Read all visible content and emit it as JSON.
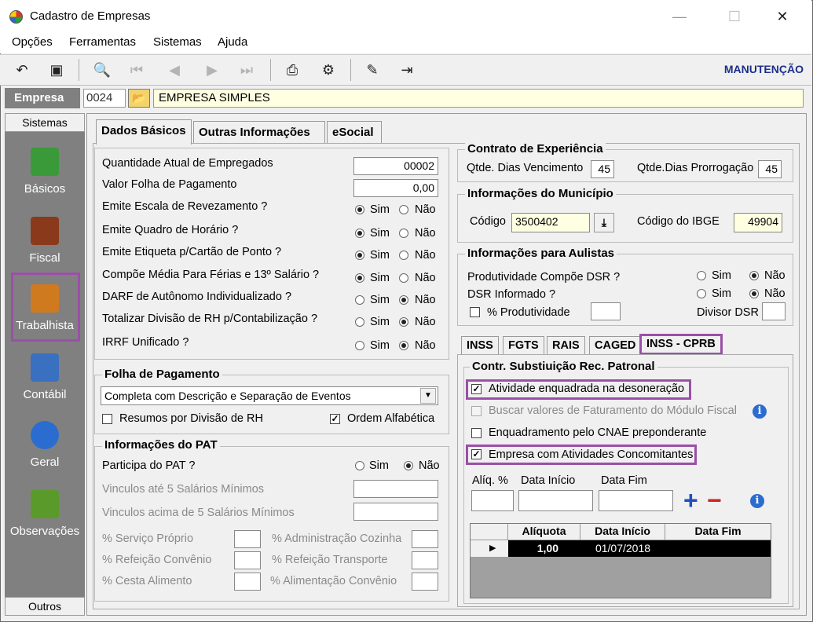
{
  "window": {
    "title": "Cadastro de Empresas",
    "minimize": "—",
    "maximize": "☐",
    "close": "✕"
  },
  "menu": [
    "Opções",
    "Ferramentas",
    "Sistemas",
    "Ajuda"
  ],
  "toolbar": {
    "mode": "MANUTENÇÃO"
  },
  "empresa": {
    "label": "Empresa",
    "code": "0024",
    "name": "EMPRESA SIMPLES"
  },
  "sidebar": {
    "header": "Sistemas",
    "footer": "Outros",
    "items": [
      {
        "label": "Básicos",
        "color": "#3a9a3a"
      },
      {
        "label": "Fiscal",
        "color": "#8a3a1a"
      },
      {
        "label": "Trabalhista",
        "color": "#d07a20"
      },
      {
        "label": "Contábil",
        "color": "#3a70c0"
      },
      {
        "label": "Geral",
        "color": "#2b6cd0"
      },
      {
        "label": "Observações",
        "color": "#5a9a2a"
      }
    ]
  },
  "tabs": [
    "Dados Básicos",
    "Outras Informações",
    "eSocial"
  ],
  "basic": {
    "rows": [
      {
        "label": "Quantidade Atual de Empregados",
        "value": "00002"
      },
      {
        "label": "Valor Folha de Pagamento",
        "value": "0,00"
      }
    ],
    "radio_rows": [
      {
        "label": "Emite Escala de Revezamento ?",
        "sel": "sim"
      },
      {
        "label": "Emite Quadro de Horário ?",
        "sel": "sim"
      },
      {
        "label": "Emite Etiqueta p/Cartão de Ponto ?",
        "sel": "sim"
      },
      {
        "label": "Compõe Média Para Férias e 13º Salário ?",
        "sel": "sim"
      },
      {
        "label": "DARF de Autônomo Individualizado ?",
        "sel": "nao"
      },
      {
        "label": "Totalizar Divisão de RH p/Contabilização ?",
        "sel": "nao"
      },
      {
        "label": "IRRF Unificado ?",
        "sel": "nao"
      }
    ],
    "sim": "Sim",
    "nao": "Não"
  },
  "folha": {
    "title": "Folha de Pagamento",
    "select": "Completa com Descrição e Separação de Eventos",
    "resumos": "Resumos por Divisão de RH",
    "ordem": "Ordem Alfabética"
  },
  "pat": {
    "title": "Informações do PAT",
    "participa": "Participa do PAT ?",
    "vinc5": "Vinculos até 5 Salários Mínimos",
    "vinc5mais": "Vinculos acima de 5 Salários Mínimos",
    "servico": "% Serviço Próprio",
    "refeicao": "% Refeição Convênio",
    "cesta": "% Cesta Alimento",
    "admin": "% Administração Cozinha",
    "transporte": "% Refeição Transporte",
    "alimentacao": "% Alimentação Convênio"
  },
  "contrato": {
    "title": "Contrato de Experiência",
    "venc_label": "Qtde. Dias Vencimento",
    "venc": "45",
    "prorr_label": "Qtde.Dias Prorrogação",
    "prorr": "45"
  },
  "municipio": {
    "title": "Informações do Município",
    "codigo_label": "Código",
    "codigo": "3500402",
    "ibge_label": "Código do IBGE",
    "ibge": "49904"
  },
  "aulistas": {
    "title": "Informações para Aulistas",
    "prod": "Produtividade Compõe DSR ?",
    "dsr": "DSR Informado ?",
    "pct": "% Produtividade",
    "divisor": "Divisor DSR"
  },
  "subtabs": [
    "INSS",
    "FGTS",
    "RAIS",
    "CAGED",
    "INSS - CPRB"
  ],
  "cprb": {
    "title": "Contr. Substiuição Rec. Patronal",
    "c1": "Atividade enquadrada na desoneração",
    "c2": "Buscar valores de Faturamento do Módulo Fiscal",
    "c3": "Enquadramento pelo CNAE preponderante",
    "c4": "Empresa com Atividades Concomitantes",
    "aliq": "Alíq. %",
    "inicio": "Data Início",
    "fim": "Data Fim",
    "plus": "+",
    "minus": "−",
    "info": "i",
    "grid_headers": [
      "Alíquota",
      "Data Início",
      "Data Fim"
    ],
    "grid_rows": [
      {
        "aliquota": "1,00",
        "inicio": "01/07/2018",
        "fim": ""
      }
    ]
  }
}
